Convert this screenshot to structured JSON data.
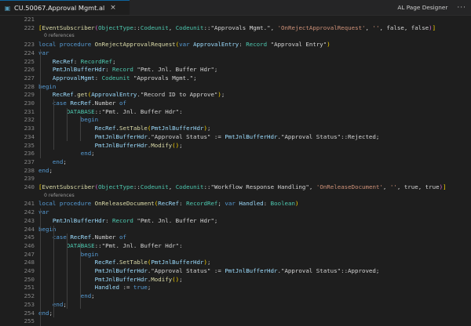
{
  "tab": {
    "icon_name": "al-file-icon",
    "label": "CU.50067.Approval Mgmt.al",
    "close_glyph": "×"
  },
  "action": {
    "label": "AL Page Designer",
    "more_glyph": "···"
  },
  "colors": {
    "keyword": "#569cd6",
    "type": "#4ec9b0",
    "function": "#dcdcaa",
    "string": "#ce9178",
    "variable": "#9cdcfe",
    "bracket": "#ffd700",
    "bracket_nested": "#da70d6",
    "default": "#d4d4d4",
    "line_number": "#858585",
    "codelens": "#999999"
  },
  "lines": [
    {
      "n": "221",
      "tokens": []
    },
    {
      "n": "222",
      "tokens": [
        {
          "t": "[",
          "c": "brk"
        },
        {
          "t": "EventSubscriber",
          "c": "fn"
        },
        {
          "t": "(",
          "c": "brk2"
        },
        {
          "t": "ObjectType",
          "c": "ty"
        },
        {
          "t": "::",
          "c": "plain"
        },
        {
          "t": "Codeunit",
          "c": "ty"
        },
        {
          "t": ", ",
          "c": "plain"
        },
        {
          "t": "Codeunit",
          "c": "ty"
        },
        {
          "t": "::",
          "c": "plain"
        },
        {
          "t": "\"Approvals Mgmt.\"",
          "c": "plain"
        },
        {
          "t": ", ",
          "c": "plain"
        },
        {
          "t": "'OnRejectApprovalRequest'",
          "c": "str"
        },
        {
          "t": ", ",
          "c": "plain"
        },
        {
          "t": "''",
          "c": "str"
        },
        {
          "t": ", false, false",
          "c": "plain"
        },
        {
          "t": ")",
          "c": "brk2"
        },
        {
          "t": "]",
          "c": "brk"
        }
      ]
    },
    {
      "lens": "0 references"
    },
    {
      "n": "223",
      "tokens": [
        {
          "t": "local ",
          "c": "kw"
        },
        {
          "t": "procedure ",
          "c": "kw"
        },
        {
          "t": "OnRejectApprovalRequest",
          "c": "fn"
        },
        {
          "t": "(",
          "c": "brk"
        },
        {
          "t": "var ",
          "c": "kw"
        },
        {
          "t": "ApprovalEntry",
          "c": "var"
        },
        {
          "t": ": ",
          "c": "plain"
        },
        {
          "t": "Record ",
          "c": "ty"
        },
        {
          "t": "\"Approval Entry\"",
          "c": "plain"
        },
        {
          "t": ")",
          "c": "brk"
        }
      ]
    },
    {
      "n": "224",
      "tokens": [
        {
          "t": "var",
          "c": "kw"
        }
      ]
    },
    {
      "n": "225",
      "tokens": [
        {
          "t": "    RecRef",
          "c": "var"
        },
        {
          "t": ": ",
          "c": "plain"
        },
        {
          "t": "RecordRef",
          "c": "ty"
        },
        {
          "t": ";",
          "c": "plain"
        }
      ]
    },
    {
      "n": "226",
      "tokens": [
        {
          "t": "    PmtJnlBufferHdr",
          "c": "var"
        },
        {
          "t": ": ",
          "c": "plain"
        },
        {
          "t": "Record ",
          "c": "ty"
        },
        {
          "t": "\"Pmt. Jnl. Buffer Hdr\"",
          "c": "plain"
        },
        {
          "t": ";",
          "c": "plain"
        }
      ]
    },
    {
      "n": "227",
      "tokens": [
        {
          "t": "    ApprovalMgmt",
          "c": "var"
        },
        {
          "t": ": ",
          "c": "plain"
        },
        {
          "t": "Codeunit ",
          "c": "ty"
        },
        {
          "t": "\"Approvals Mgmt.\"",
          "c": "plain"
        },
        {
          "t": ";",
          "c": "plain"
        }
      ]
    },
    {
      "n": "228",
      "tokens": [
        {
          "t": "begin",
          "c": "kw"
        }
      ]
    },
    {
      "n": "229",
      "tokens": [
        {
          "t": "    RecRef",
          "c": "var"
        },
        {
          "t": ".",
          "c": "plain"
        },
        {
          "t": "get",
          "c": "fn"
        },
        {
          "t": "(",
          "c": "brk"
        },
        {
          "t": "ApprovalEntry",
          "c": "var"
        },
        {
          "t": ".\"Record ID to Approve\"",
          "c": "plain"
        },
        {
          "t": ")",
          "c": "brk"
        },
        {
          "t": ";",
          "c": "plain"
        }
      ]
    },
    {
      "n": "230",
      "tokens": [
        {
          "t": "    case ",
          "c": "kw"
        },
        {
          "t": "RecRef",
          "c": "var"
        },
        {
          "t": ".Number ",
          "c": "plain"
        },
        {
          "t": "of",
          "c": "kw"
        }
      ]
    },
    {
      "n": "231",
      "tokens": [
        {
          "t": "        DATABASE",
          "c": "ty"
        },
        {
          "t": "::\"Pmt. Jnl. Buffer Hdr\":",
          "c": "plain"
        }
      ]
    },
    {
      "n": "232",
      "tokens": [
        {
          "t": "            begin",
          "c": "kw"
        }
      ]
    },
    {
      "n": "233",
      "tokens": [
        {
          "t": "                RecRef",
          "c": "var"
        },
        {
          "t": ".",
          "c": "plain"
        },
        {
          "t": "SetTable",
          "c": "fn"
        },
        {
          "t": "(",
          "c": "brk"
        },
        {
          "t": "PmtJnlBufferHdr",
          "c": "var"
        },
        {
          "t": ")",
          "c": "brk"
        },
        {
          "t": ";",
          "c": "plain"
        }
      ]
    },
    {
      "n": "234",
      "tokens": [
        {
          "t": "                PmtJnlBufferHdr",
          "c": "var"
        },
        {
          "t": ".\"Approval Status\" := ",
          "c": "plain"
        },
        {
          "t": "PmtJnlBufferHdr",
          "c": "var"
        },
        {
          "t": ".\"Approval Status\"::Rejected;",
          "c": "plain"
        }
      ]
    },
    {
      "n": "235",
      "tokens": [
        {
          "t": "                PmtJnlBufferHdr",
          "c": "var"
        },
        {
          "t": ".",
          "c": "plain"
        },
        {
          "t": "Modify",
          "c": "fn"
        },
        {
          "t": "()",
          "c": "brk"
        },
        {
          "t": ";",
          "c": "plain"
        }
      ]
    },
    {
      "n": "236",
      "tokens": [
        {
          "t": "            end",
          "c": "kw"
        },
        {
          "t": ";",
          "c": "plain"
        }
      ]
    },
    {
      "n": "237",
      "tokens": [
        {
          "t": "    end",
          "c": "kw"
        },
        {
          "t": ";",
          "c": "plain"
        }
      ]
    },
    {
      "n": "238",
      "tokens": [
        {
          "t": "end",
          "c": "kw"
        },
        {
          "t": ";",
          "c": "plain"
        }
      ]
    },
    {
      "n": "239",
      "tokens": []
    },
    {
      "n": "240",
      "tokens": [
        {
          "t": "[",
          "c": "brk"
        },
        {
          "t": "EventSubscriber",
          "c": "fn"
        },
        {
          "t": "(",
          "c": "brk2"
        },
        {
          "t": "ObjectType",
          "c": "ty"
        },
        {
          "t": "::",
          "c": "plain"
        },
        {
          "t": "Codeunit",
          "c": "ty"
        },
        {
          "t": ", ",
          "c": "plain"
        },
        {
          "t": "Codeunit",
          "c": "ty"
        },
        {
          "t": "::",
          "c": "plain"
        },
        {
          "t": "\"Workflow Response Handling\"",
          "c": "plain"
        },
        {
          "t": ", ",
          "c": "plain"
        },
        {
          "t": "'OnReleaseDocument'",
          "c": "str"
        },
        {
          "t": ", ",
          "c": "plain"
        },
        {
          "t": "''",
          "c": "str"
        },
        {
          "t": ", true, true",
          "c": "plain"
        },
        {
          "t": ")",
          "c": "brk2"
        },
        {
          "t": "]",
          "c": "brk"
        }
      ]
    },
    {
      "lens": "0 references"
    },
    {
      "n": "241",
      "tokens": [
        {
          "t": "local ",
          "c": "kw"
        },
        {
          "t": "procedure ",
          "c": "kw"
        },
        {
          "t": "OnReleaseDocument",
          "c": "fn"
        },
        {
          "t": "(",
          "c": "brk"
        },
        {
          "t": "RecRef",
          "c": "var"
        },
        {
          "t": ": ",
          "c": "plain"
        },
        {
          "t": "RecordRef",
          "c": "ty"
        },
        {
          "t": "; ",
          "c": "plain"
        },
        {
          "t": "var ",
          "c": "kw"
        },
        {
          "t": "Handled",
          "c": "var"
        },
        {
          "t": ": ",
          "c": "plain"
        },
        {
          "t": "Boolean",
          "c": "ty"
        },
        {
          "t": ")",
          "c": "brk"
        }
      ]
    },
    {
      "n": "242",
      "tokens": [
        {
          "t": "var",
          "c": "kw"
        }
      ]
    },
    {
      "n": "243",
      "tokens": [
        {
          "t": "    PmtJnlBufferHdr",
          "c": "var"
        },
        {
          "t": ": ",
          "c": "plain"
        },
        {
          "t": "Record ",
          "c": "ty"
        },
        {
          "t": "\"Pmt. Jnl. Buffer Hdr\"",
          "c": "plain"
        },
        {
          "t": ";",
          "c": "plain"
        }
      ]
    },
    {
      "n": "244",
      "tokens": [
        {
          "t": "begin",
          "c": "kw"
        }
      ]
    },
    {
      "n": "245",
      "tokens": [
        {
          "t": "    case ",
          "c": "kw"
        },
        {
          "t": "RecRef",
          "c": "var"
        },
        {
          "t": ".Number ",
          "c": "plain"
        },
        {
          "t": "of",
          "c": "kw"
        }
      ]
    },
    {
      "n": "246",
      "tokens": [
        {
          "t": "        DATABASE",
          "c": "ty"
        },
        {
          "t": "::\"Pmt. Jnl. Buffer Hdr\":",
          "c": "plain"
        }
      ]
    },
    {
      "n": "247",
      "tokens": [
        {
          "t": "            begin",
          "c": "kw"
        }
      ]
    },
    {
      "n": "248",
      "tokens": [
        {
          "t": "                RecRef",
          "c": "var"
        },
        {
          "t": ".",
          "c": "plain"
        },
        {
          "t": "SetTable",
          "c": "fn"
        },
        {
          "t": "(",
          "c": "brk"
        },
        {
          "t": "PmtJnlBufferHdr",
          "c": "var"
        },
        {
          "t": ")",
          "c": "brk"
        },
        {
          "t": ";",
          "c": "plain"
        }
      ]
    },
    {
      "n": "249",
      "tokens": [
        {
          "t": "                PmtJnlBufferHdr",
          "c": "var"
        },
        {
          "t": ".\"Approval Status\" := ",
          "c": "plain"
        },
        {
          "t": "PmtJnlBufferHdr",
          "c": "var"
        },
        {
          "t": ".\"Approval Status\"::Approved;",
          "c": "plain"
        }
      ]
    },
    {
      "n": "250",
      "tokens": [
        {
          "t": "                PmtJnlBufferHdr",
          "c": "var"
        },
        {
          "t": ".",
          "c": "plain"
        },
        {
          "t": "Modify",
          "c": "fn"
        },
        {
          "t": "()",
          "c": "brk"
        },
        {
          "t": ";",
          "c": "plain"
        }
      ]
    },
    {
      "n": "251",
      "tokens": [
        {
          "t": "                Handled",
          "c": "var"
        },
        {
          "t": " := ",
          "c": "plain"
        },
        {
          "t": "true",
          "c": "kw"
        },
        {
          "t": ";",
          "c": "plain"
        }
      ]
    },
    {
      "n": "252",
      "tokens": [
        {
          "t": "            end",
          "c": "kw"
        },
        {
          "t": ";",
          "c": "plain"
        }
      ]
    },
    {
      "n": "253",
      "tokens": [
        {
          "t": "    end",
          "c": "kw"
        },
        {
          "t": ";",
          "c": "plain"
        }
      ]
    },
    {
      "n": "254",
      "tokens": [
        {
          "t": "end",
          "c": "kw"
        },
        {
          "t": ";",
          "c": "plain"
        }
      ]
    },
    {
      "n": "255",
      "tokens": []
    }
  ]
}
